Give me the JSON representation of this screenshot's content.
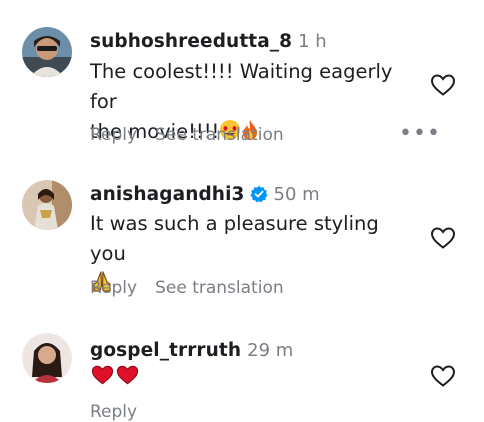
{
  "comments": [
    {
      "username": "subhoshreedutta_8",
      "time": "1 h",
      "text_line1": "The coolest!!!! Waiting eagerly for",
      "text_line2": "the movie!!!!",
      "emoji": [
        "heart-eyes-emoji",
        "fire-emoji"
      ],
      "reply_label": "Reply",
      "translation_label": "See translation",
      "more_label": "•••"
    },
    {
      "username": "anishagandhi3",
      "verified": true,
      "time": "50 m",
      "text_line1": "It was such a pleasure styling you",
      "emoji": [
        "praying-hands-emoji"
      ],
      "reply_label": "Reply",
      "translation_label": "See translation"
    },
    {
      "username": "gospel_trrruth",
      "time": "29 m",
      "emoji": [
        "red-heart-emoji",
        "red-heart-emoji"
      ],
      "reply_label": "Reply"
    }
  ],
  "colors": {
    "text": "#1c1e21",
    "secondary": "#7a7e85",
    "verified": "#0095f6",
    "heart_red": "#e0102a"
  }
}
